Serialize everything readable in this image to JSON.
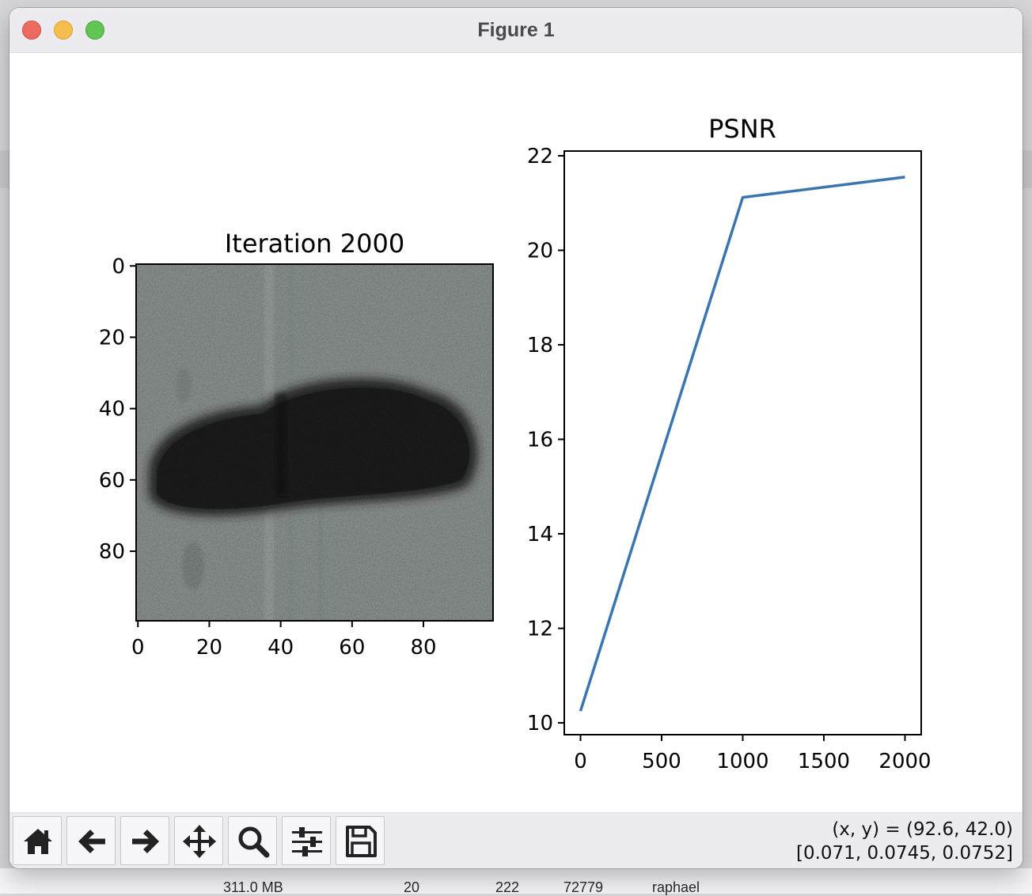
{
  "window": {
    "title": "Figure 1"
  },
  "left_panel": {
    "title": "Iteration 2000",
    "x_ticks": [
      "0",
      "20",
      "40",
      "60",
      "80"
    ],
    "y_ticks": [
      "0",
      "20",
      "40",
      "60",
      "80"
    ]
  },
  "chart_data": {
    "type": "line",
    "title": "PSNR",
    "xlabel": "",
    "ylabel": "",
    "x": [
      0,
      1000,
      2000
    ],
    "series": [
      {
        "values": [
          10.25,
          21.12,
          21.55
        ],
        "color": "#3b75af"
      }
    ],
    "xlim": [
      -100,
      2100
    ],
    "ylim": [
      9.75,
      22.1
    ],
    "x_ticks": [
      "0",
      "500",
      "1000",
      "1500",
      "2000"
    ],
    "y_ticks": [
      "10",
      "12",
      "14",
      "16",
      "18",
      "20",
      "22"
    ],
    "grid": false
  },
  "toolbar": {
    "buttons": [
      {
        "icon": "home-icon"
      },
      {
        "icon": "back-arrow-icon"
      },
      {
        "icon": "forward-arrow-icon"
      },
      {
        "icon": "pan-icon"
      },
      {
        "icon": "zoom-icon"
      },
      {
        "icon": "configure-subplots-icon"
      },
      {
        "icon": "save-icon"
      }
    ],
    "coord_line1": "(x, y) = (92.6, 42.0)",
    "coord_line2": "[0.071, 0.0745, 0.0752]"
  },
  "background_app": {
    "cells": [
      "311.0 MB",
      "20",
      "222",
      "72779",
      "raphael"
    ]
  }
}
